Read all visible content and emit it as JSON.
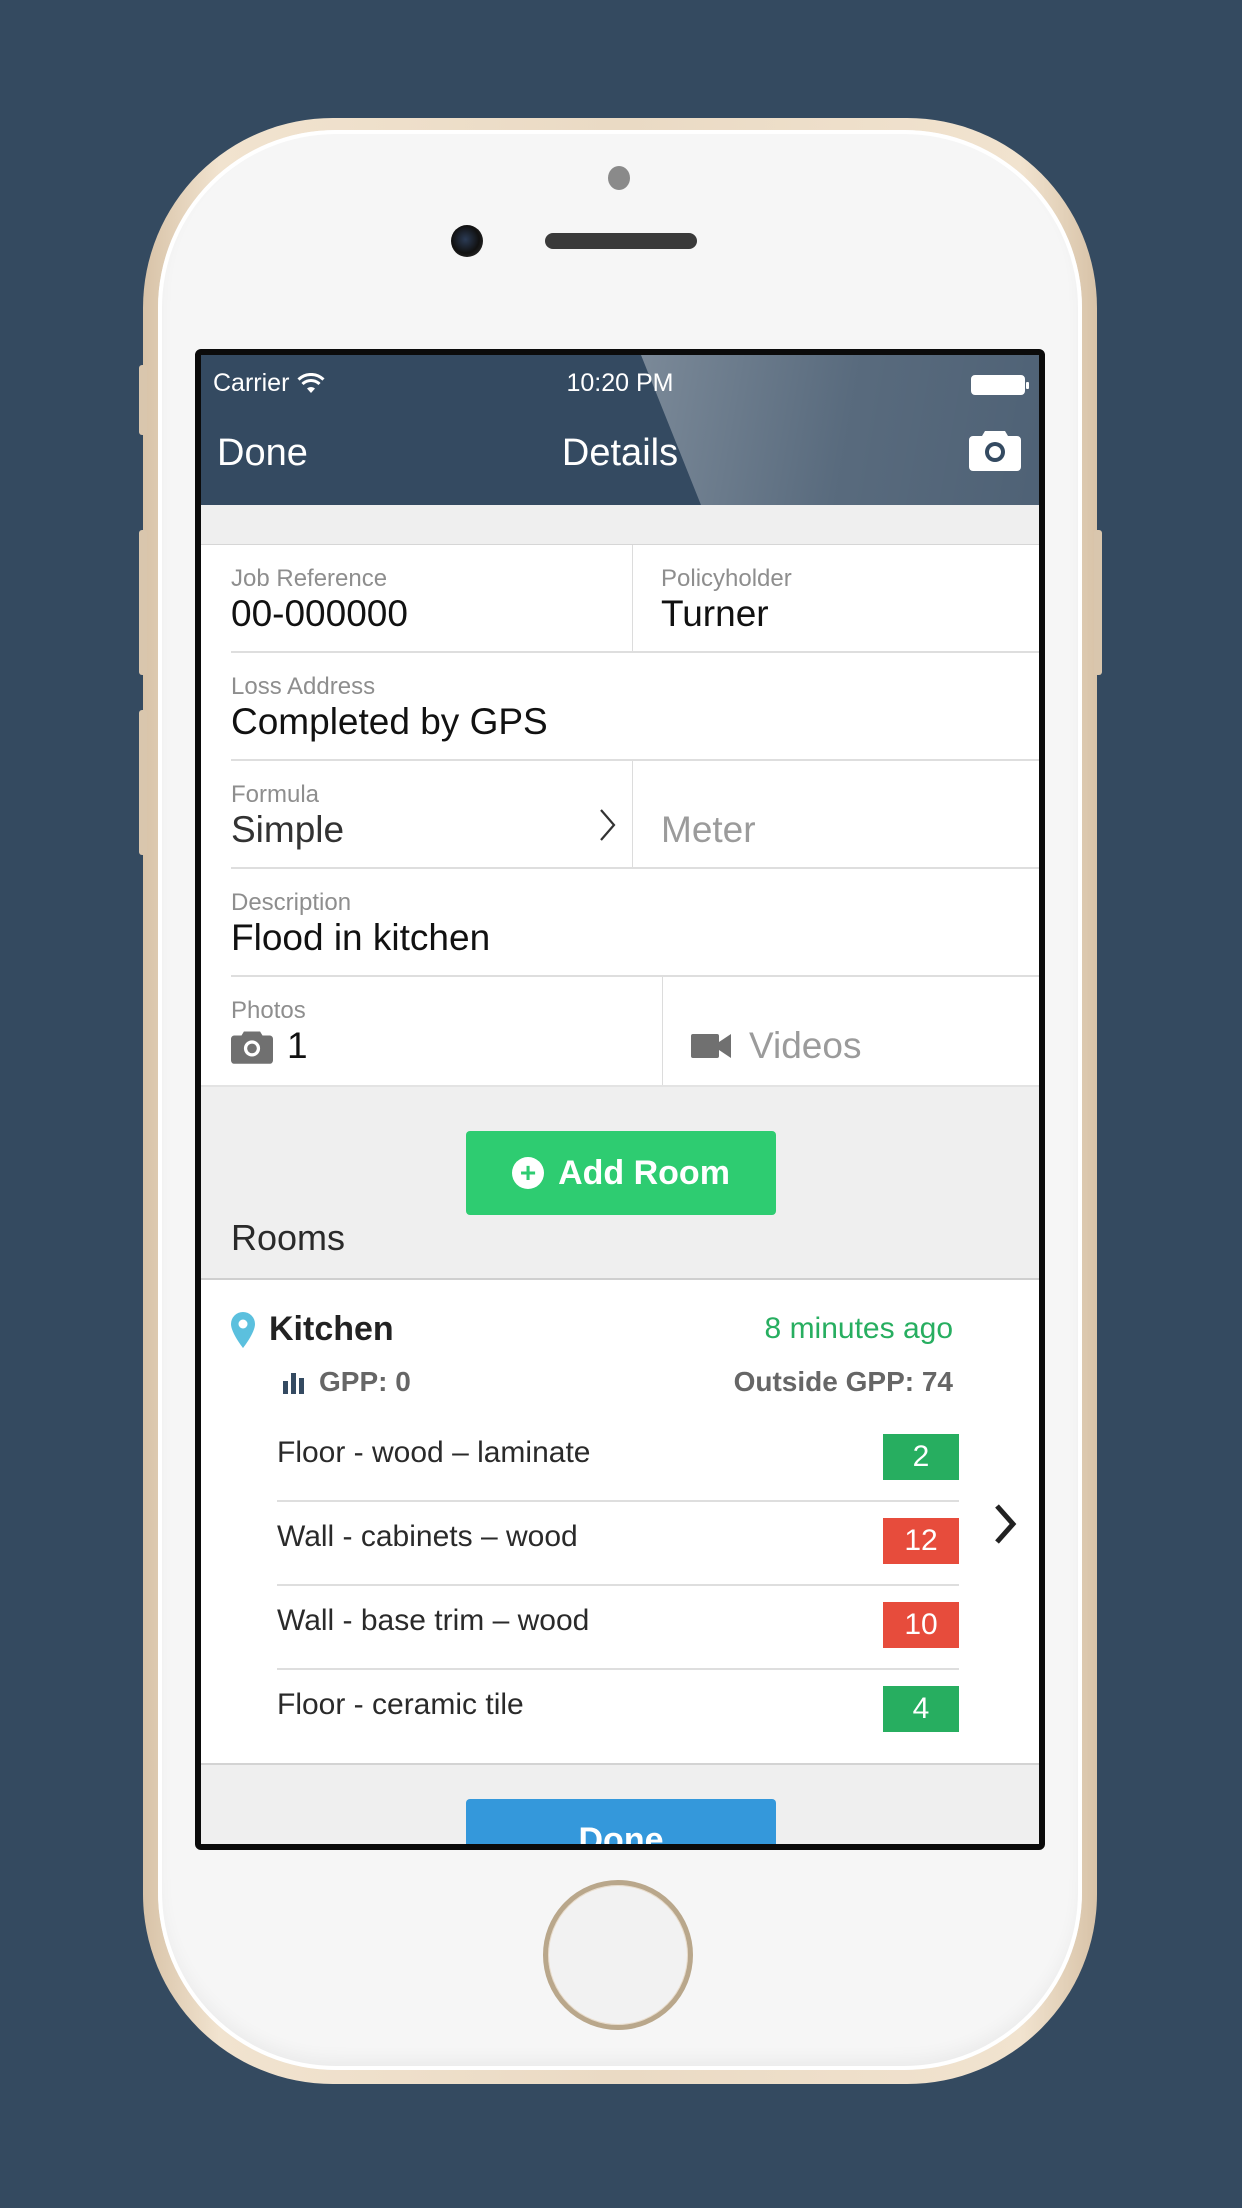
{
  "status_bar": {
    "carrier": "Carrier",
    "time": "10:20 PM"
  },
  "nav": {
    "left_button": "Done",
    "title": "Details",
    "right_icon": "camera-icon"
  },
  "form": {
    "job_reference": {
      "label": "Job Reference",
      "value": "00-000000"
    },
    "policyholder": {
      "label": "Policyholder",
      "value": "Turner"
    },
    "loss_address": {
      "label": "Loss Address",
      "value": "Completed by GPS"
    },
    "formula": {
      "label": "Formula",
      "value": "Simple"
    },
    "meter": {
      "placeholder": "Meter"
    },
    "description": {
      "label": "Description",
      "value": "Flood in kitchen"
    },
    "photos": {
      "label": "Photos",
      "count": "1"
    },
    "videos": {
      "label": "Videos"
    }
  },
  "add_room_button": "Add Room",
  "rooms_title": "Rooms",
  "rooms": [
    {
      "name": "Kitchen",
      "updated": "8 minutes ago",
      "gpp": "GPP: 0",
      "outside_gpp": "Outside GPP: 74",
      "items": [
        {
          "label": "Floor - wood – laminate",
          "value": "2",
          "status": "ok"
        },
        {
          "label": "Wall - cabinets – wood",
          "value": "12",
          "status": "wet"
        },
        {
          "label": "Wall - base trim – wood",
          "value": "10",
          "status": "wet"
        },
        {
          "label": "Floor - ceramic tile",
          "value": "4",
          "status": "ok"
        }
      ]
    }
  ],
  "done_button": "Done",
  "colors": {
    "nav_bg": "#344a61",
    "add_green": "#2ecc71",
    "done_blue": "#3498db",
    "badge_ok": "#27ae60",
    "badge_wet": "#e74c3c",
    "time_green": "#27ae60",
    "pin_blue": "#5bc0de"
  }
}
